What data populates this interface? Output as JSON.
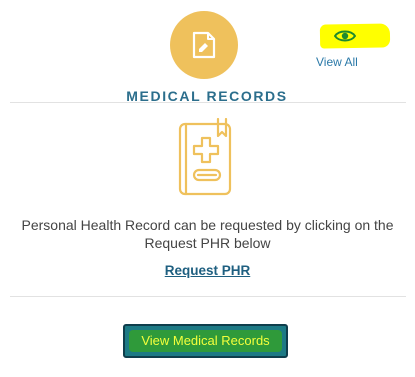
{
  "header": {
    "icon": "document-edit-icon",
    "title": "MEDICAL RECORDS",
    "accent_color": "#efc15c",
    "title_color": "#2b6e8c"
  },
  "view_all": {
    "icon": "eye-icon",
    "label": "View All",
    "highlight_color": "#ffff00"
  },
  "body": {
    "illustration": "medical-record-book-icon",
    "description": "Personal Health Record can be requested by clicking on the Request PHR below",
    "request_link": "Request PHR"
  },
  "footer": {
    "button_label": "View Medical Records",
    "button_color": "#1d7a85",
    "highlight_color": "#2f9a3a"
  }
}
